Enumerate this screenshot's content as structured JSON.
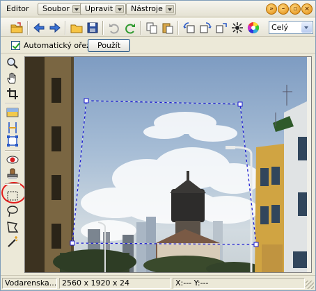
{
  "app_title": "Editor",
  "menus": [
    {
      "label": "Soubor"
    },
    {
      "label": "Upravit"
    },
    {
      "label": "Nástroje"
    }
  ],
  "window_controls": [
    "chevron-down-icon",
    "minimize-icon",
    "restore-icon",
    "close-icon"
  ],
  "toolbar": {
    "zoom_value": "Celý",
    "icons": [
      "open-folder-icon",
      "back-arrow-icon",
      "forward-arrow-icon",
      "open-icon",
      "save-icon",
      "undo-icon",
      "redo-icon",
      "copy-icon",
      "paste-icon",
      "rotate-left-icon",
      "rotate-right-icon",
      "flip-icon",
      "fullscreen-icon",
      "color-wheel-icon"
    ]
  },
  "options": {
    "auto_crop_label": "Automatický ořez",
    "auto_crop_checked": true,
    "apply_label": "Použít"
  },
  "tools": [
    "zoom-icon",
    "hand-icon",
    "crop-icon",
    "gradient-icon",
    "straighten-icon",
    "perspective-crop-icon",
    "red-eye-icon",
    "stamp-icon",
    "rect-select-icon",
    "lasso-icon",
    "polygon-select-icon",
    "magic-wand-icon"
  ],
  "status": {
    "filename": "Vodarenska...",
    "dimensions": "2560 x 1920 x 24",
    "coords": "X:--- Y:---"
  },
  "colors": {
    "highlight": "#e21b1b",
    "selection": "#1a1ad0"
  }
}
